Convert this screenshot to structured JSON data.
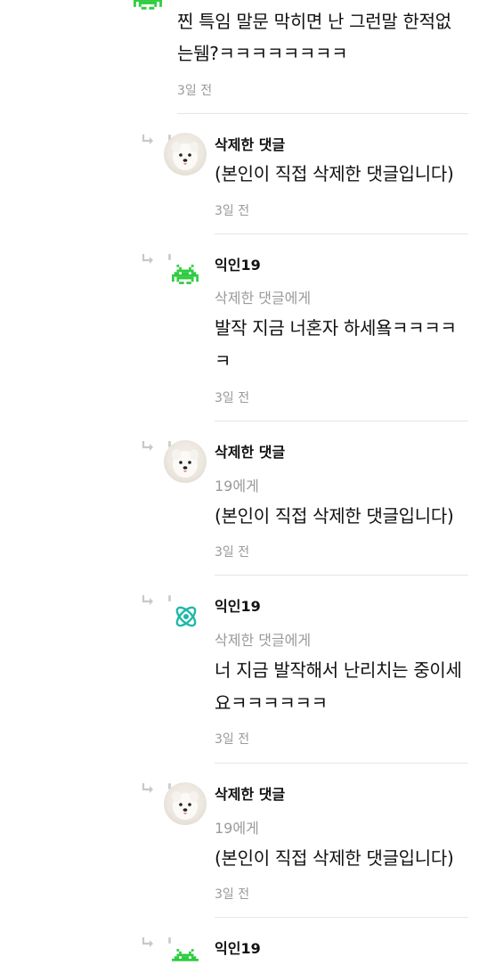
{
  "top_comment": {
    "text_line1": "찐 특임 말문 막히면 난 그런말 한적없",
    "text_line2": "는뒘?ㅋㅋㅋㅋㅋㅋㅋㅋ",
    "time": "3일 전"
  },
  "replies": [
    {
      "author": "삭제한 댓글",
      "text": "(본인이 직접 삭제한 댓글입니다)",
      "time": "3일 전",
      "avatar": "dog-photo"
    },
    {
      "author": "익인19",
      "mention": "삭제한 댓글에게",
      "text_line1": "발작 지금 너혼자 하세욬ㅋㅋㅋㅋ",
      "text_line2": "ㅋ",
      "time": "3일 전",
      "avatar": "space-invader-icon",
      "avatar_color": "#2ecc40"
    },
    {
      "author": "삭제한 댓글",
      "mention": "19에게",
      "text": "(본인이 직접 삭제한 댓글입니다)",
      "time": "3일 전",
      "avatar": "dog-photo"
    },
    {
      "author": "익인19",
      "mention": "삭제한 댓글에게",
      "text_line1": "너 지금 발작해서 난리치는 중이세",
      "text_line2": "요ㅋㅋㅋㅋㅋㅋ",
      "time": "3일 전",
      "avatar": "atom-icon",
      "avatar_color": "#1fb8a8"
    },
    {
      "author": "삭제한 댓글",
      "mention": "19에게",
      "text": "(본인이 직접 삭제한 댓글입니다)",
      "time": "3일 전",
      "avatar": "dog-photo"
    },
    {
      "author": "익인19",
      "avatar": "space-invader-icon",
      "avatar_color": "#2ecc40"
    }
  ]
}
